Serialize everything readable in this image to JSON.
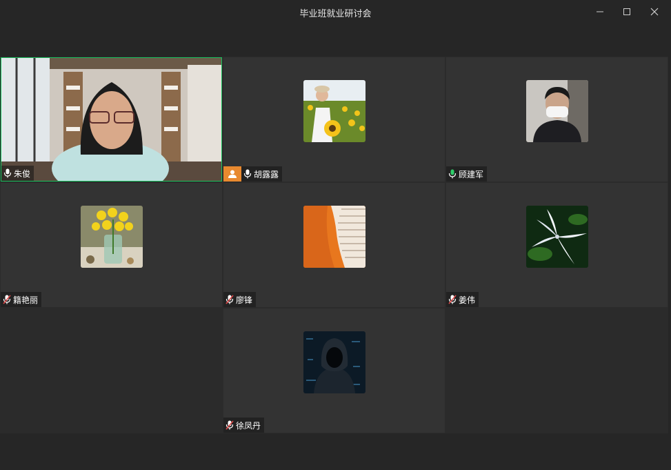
{
  "window": {
    "title": "毕业班就业研讨会"
  },
  "participants": [
    {
      "name": "朱俊",
      "mic": "on",
      "active": true,
      "video": "room"
    },
    {
      "name": "胡露露",
      "mic": "on",
      "host": true,
      "avatar": "sunflower-field"
    },
    {
      "name": "顾建军",
      "mic": "on",
      "avatar": "man-with-mask"
    },
    {
      "name": "籍艳丽",
      "mic": "muted",
      "avatar": "daffodils"
    },
    {
      "name": "廖锋",
      "mic": "muted",
      "avatar": "orange-abstract"
    },
    {
      "name": "姜伟",
      "mic": "muted",
      "avatar": "white-flower"
    },
    {
      "name": "徐凤丹",
      "mic": "muted",
      "avatar": "hooded-figure"
    }
  ],
  "colors": {
    "active_border": "#17c25e",
    "host_badge": "#e8892f",
    "mic_on": "#ffffff",
    "mic_muted": "#e04848"
  }
}
